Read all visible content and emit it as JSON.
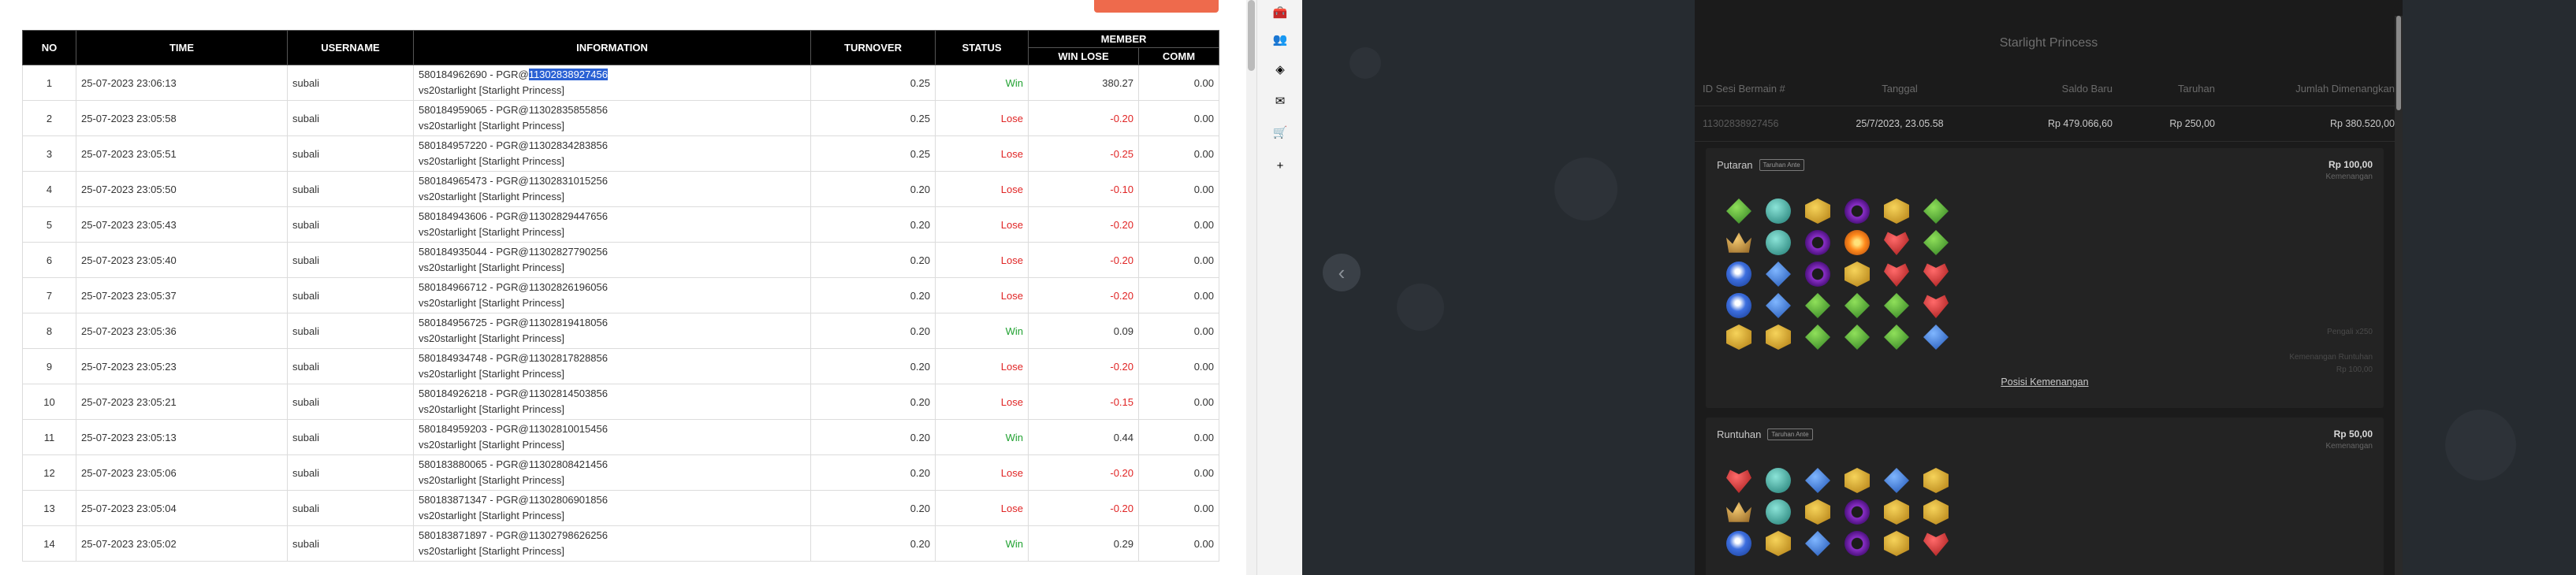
{
  "report": {
    "headers": {
      "no": "NO",
      "time": "TIME",
      "username": "USERNAME",
      "information": "INFORMATION",
      "turnover": "TURNOVER",
      "status": "STATUS",
      "member": "MEMBER",
      "win_lose": "WIN LOSE",
      "comm": "COMM"
    },
    "rows": [
      {
        "no": "1",
        "time": "25-07-2023 23:06:13",
        "username": "subali",
        "info_pre": "580184962690 - PGR@",
        "info_id": "11302838927456",
        "info_game": "vs20starlight [Starlight Princess]",
        "turnover": "0.25",
        "status": "Win",
        "win_lose": "380.27",
        "comm": "0.00",
        "highlight": true
      },
      {
        "no": "2",
        "time": "25-07-2023 23:05:58",
        "username": "subali",
        "info_pre": "580184959065 - PGR@",
        "info_id": "11302835855856",
        "info_game": "vs20starlight [Starlight Princess]",
        "turnover": "0.25",
        "status": "Lose",
        "win_lose": "-0.20",
        "comm": "0.00"
      },
      {
        "no": "3",
        "time": "25-07-2023 23:05:51",
        "username": "subali",
        "info_pre": "580184957220 - PGR@",
        "info_id": "11302834283856",
        "info_game": "vs20starlight [Starlight Princess]",
        "turnover": "0.25",
        "status": "Lose",
        "win_lose": "-0.25",
        "comm": "0.00"
      },
      {
        "no": "4",
        "time": "25-07-2023 23:05:50",
        "username": "subali",
        "info_pre": "580184965473 - PGR@",
        "info_id": "11302831015256",
        "info_game": "vs20starlight [Starlight Princess]",
        "turnover": "0.20",
        "status": "Lose",
        "win_lose": "-0.10",
        "comm": "0.00"
      },
      {
        "no": "5",
        "time": "25-07-2023 23:05:43",
        "username": "subali",
        "info_pre": "580184943606 - PGR@",
        "info_id": "11302829447656",
        "info_game": "vs20starlight [Starlight Princess]",
        "turnover": "0.20",
        "status": "Lose",
        "win_lose": "-0.20",
        "comm": "0.00"
      },
      {
        "no": "6",
        "time": "25-07-2023 23:05:40",
        "username": "subali",
        "info_pre": "580184935044 - PGR@",
        "info_id": "11302827790256",
        "info_game": "vs20starlight [Starlight Princess]",
        "turnover": "0.20",
        "status": "Lose",
        "win_lose": "-0.20",
        "comm": "0.00"
      },
      {
        "no": "7",
        "time": "25-07-2023 23:05:37",
        "username": "subali",
        "info_pre": "580184966712 - PGR@",
        "info_id": "11302826196056",
        "info_game": "vs20starlight [Starlight Princess]",
        "turnover": "0.20",
        "status": "Lose",
        "win_lose": "-0.20",
        "comm": "0.00"
      },
      {
        "no": "8",
        "time": "25-07-2023 23:05:36",
        "username": "subali",
        "info_pre": "580184956725 - PGR@",
        "info_id": "11302819418056",
        "info_game": "vs20starlight [Starlight Princess]",
        "turnover": "0.20",
        "status": "Win",
        "win_lose": "0.09",
        "comm": "0.00"
      },
      {
        "no": "9",
        "time": "25-07-2023 23:05:23",
        "username": "subali",
        "info_pre": "580184934748 - PGR@",
        "info_id": "11302817828856",
        "info_game": "vs20starlight [Starlight Princess]",
        "turnover": "0.20",
        "status": "Lose",
        "win_lose": "-0.20",
        "comm": "0.00"
      },
      {
        "no": "10",
        "time": "25-07-2023 23:05:21",
        "username": "subali",
        "info_pre": "580184926218 - PGR@",
        "info_id": "11302814503856",
        "info_game": "vs20starlight [Starlight Princess]",
        "turnover": "0.20",
        "status": "Lose",
        "win_lose": "-0.15",
        "comm": "0.00"
      },
      {
        "no": "11",
        "time": "25-07-2023 23:05:13",
        "username": "subali",
        "info_pre": "580184959203 - PGR@",
        "info_id": "11302810015456",
        "info_game": "vs20starlight [Starlight Princess]",
        "turnover": "0.20",
        "status": "Win",
        "win_lose": "0.44",
        "comm": "0.00"
      },
      {
        "no": "12",
        "time": "25-07-2023 23:05:06",
        "username": "subali",
        "info_pre": "580183880065 - PGR@",
        "info_id": "11302808421456",
        "info_game": "vs20starlight [Starlight Princess]",
        "turnover": "0.20",
        "status": "Lose",
        "win_lose": "-0.20",
        "comm": "0.00"
      },
      {
        "no": "13",
        "time": "25-07-2023 23:05:04",
        "username": "subali",
        "info_pre": "580183871347 - PGR@",
        "info_id": "11302806901856",
        "info_game": "vs20starlight [Starlight Princess]",
        "turnover": "0.20",
        "status": "Lose",
        "win_lose": "-0.20",
        "comm": "0.00"
      },
      {
        "no": "14",
        "time": "25-07-2023 23:05:02",
        "username": "subali",
        "info_pre": "580183871897 - PGR@",
        "info_id": "11302798626256",
        "info_game": "vs20starlight [Starlight Princess]",
        "turnover": "0.20",
        "status": "Win",
        "win_lose": "0.29",
        "comm": "0.00"
      }
    ]
  },
  "sidebar_icons": [
    {
      "name": "toolbox-icon",
      "glyph": "🧰"
    },
    {
      "name": "people-icon",
      "glyph": "👥"
    },
    {
      "name": "copilot-icon",
      "glyph": "◈"
    },
    {
      "name": "outlook-icon",
      "glyph": "✉"
    },
    {
      "name": "shopping-icon",
      "glyph": "🛒"
    },
    {
      "name": "add-icon",
      "glyph": "+"
    }
  ],
  "detail": {
    "title": "Starlight Princess",
    "prev_arrow": "‹",
    "columns": {
      "session_id": "ID Sesi Bermain #",
      "date": "Tanggal",
      "balance": "Saldo Baru",
      "bet": "Taruhan",
      "won": "Jumlah Dimenangkan"
    },
    "values": {
      "session_id": "11302838927456",
      "date": "25/7/2023, 23.05.58",
      "balance": "Rp 479.066,60",
      "bet": "Rp 250,00",
      "won": "Rp 380.520,00"
    },
    "spin": {
      "title": "Putaran",
      "tag": "Taruhan Ante",
      "amount": "Rp 100,00",
      "amount_sub": "Kemenangan",
      "faint_1": "Pengali x250",
      "faint_2": "Kemenangan Runtuhan",
      "faint_3": "Rp 100,00",
      "link": "Posisi Kemenangan",
      "grid": [
        "green-gem",
        "teal-orb",
        "gold-hex",
        "purple-ring",
        "gold-hex",
        "green-gem",
        "crown",
        "teal-orb",
        "purple-ring",
        "orange-sun",
        "red-heart",
        "green-gem",
        "blue-star",
        "blue-gem",
        "purple-ring",
        "gold-hex",
        "red-heart",
        "red-heart",
        "blue-star",
        "blue-gem",
        "green-gem",
        "green-gem",
        "green-gem",
        "red-heart",
        "gold-hex",
        "gold-hex",
        "green-gem",
        "green-gem",
        "green-gem",
        "blue-gem"
      ]
    },
    "tumble": {
      "title": "Runtuhan",
      "tag": "Taruhan Ante",
      "amount": "Rp 50,00",
      "amount_sub": "Kemenangan",
      "grid": [
        "red-heart",
        "teal-orb",
        "blue-gem",
        "gold-hex",
        "blue-gem",
        "gold-hex",
        "crown",
        "teal-orb",
        "gold-hex",
        "purple-ring",
        "gold-hex",
        "gold-hex",
        "blue-star",
        "gold-hex",
        "blue-gem",
        "purple-ring",
        "gold-hex",
        "red-heart"
      ]
    }
  }
}
